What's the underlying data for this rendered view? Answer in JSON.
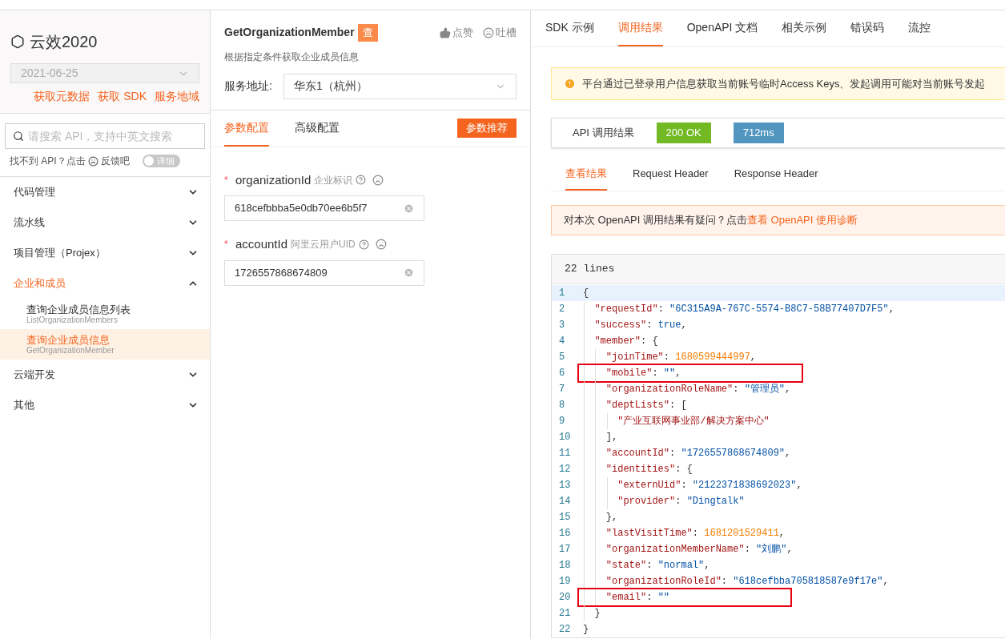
{
  "sidebar": {
    "product": "云效2020",
    "version": "2021-06-25",
    "links": [
      "获取元数据",
      "获取 SDK",
      "服务地域"
    ],
    "search": {
      "placeholder": "请搜索 API，支持中英文搜索"
    },
    "feedback": {
      "prefix": "找不到 API？点击",
      "link": "反馈吧"
    },
    "detail_toggle": {
      "label": "详细",
      "on": false
    },
    "groups": [
      {
        "label": "代码管理",
        "expanded": false
      },
      {
        "label": "流水线",
        "expanded": false
      },
      {
        "label": "项目管理（Projex）",
        "expanded": false
      },
      {
        "label": "企业和成员",
        "expanded": true,
        "children": [
          {
            "title": "查询企业成员信息列表",
            "name": "ListOrganizationMembers",
            "selected": false
          },
          {
            "title": "查询企业成员信息",
            "name": "GetOrganizationMember",
            "selected": true
          }
        ]
      },
      {
        "label": "云端开发",
        "expanded": false
      },
      {
        "label": "其他",
        "expanded": false
      }
    ]
  },
  "api": {
    "name": "GetOrganizationMember",
    "badge": "查",
    "like": "点赞",
    "complain": "吐槽",
    "description": "根据指定条件获取企业成员信息",
    "endpoint_label": "服务地址:",
    "endpoint": "华东1（杭州）",
    "tabs": [
      {
        "label": "参数配置",
        "selected": true
      },
      {
        "label": "高级配置",
        "selected": false
      }
    ],
    "recommend_button": "参数推荐",
    "params": [
      {
        "name": "organizationId",
        "hint": "企业标识",
        "required_mark": "*",
        "value": "618cefbbba5e0db70ee6b5f7"
      },
      {
        "name": "accountId",
        "hint": "阿里云用户UID",
        "required_mark": "*",
        "value": "1726557868674809"
      }
    ]
  },
  "result": {
    "tabs": [
      {
        "label": "SDK 示例",
        "selected": false
      },
      {
        "label": "调用结果",
        "selected": true
      },
      {
        "label": "OpenAPI 文档",
        "selected": false
      },
      {
        "label": "相关示例",
        "selected": false
      },
      {
        "label": "错误码",
        "selected": false
      },
      {
        "label": "流控",
        "selected": false
      }
    ],
    "warning": "平台通过已登录用户信息获取当前账号临时Access Keys、发起调用可能对当前账号发起",
    "status_label": "API 调用结果",
    "status": "200 OK",
    "duration": "712ms",
    "sub_tabs": [
      {
        "label": "查看结果",
        "selected": true
      },
      {
        "label": "Request Header",
        "selected": false
      },
      {
        "label": "Response Header",
        "selected": false
      }
    ],
    "diagnosis": {
      "text": "对本次 OpenAPI 调用结果有疑问？点击",
      "link": "查看 OpenAPI 使用诊断"
    },
    "code": {
      "line_count": "22 lines",
      "lines": [
        {
          "number": "1",
          "current": true,
          "boxed": false,
          "tokens": [
            {
              "kind": "punct",
              "text": "{"
            }
          ]
        },
        {
          "number": "2",
          "current": false,
          "boxed": false,
          "tokens": [
            {
              "kind": "key",
              "text": "  \"requestId\""
            },
            {
              "kind": "punct",
              "text": ": "
            },
            {
              "kind": "string",
              "text": "\"6C315A9A-767C-5574-B8C7-58B77407D7F5\""
            },
            {
              "kind": "punct",
              "text": ","
            }
          ]
        },
        {
          "number": "3",
          "current": false,
          "boxed": false,
          "tokens": [
            {
              "kind": "key",
              "text": "  \"success\""
            },
            {
              "kind": "punct",
              "text": ": "
            },
            {
              "kind": "string",
              "text": "true"
            },
            {
              "kind": "punct",
              "text": ","
            }
          ]
        },
        {
          "number": "4",
          "current": false,
          "boxed": false,
          "tokens": [
            {
              "kind": "key",
              "text": "  \"member\""
            },
            {
              "kind": "punct",
              "text": ": {"
            }
          ]
        },
        {
          "number": "5",
          "current": false,
          "boxed": false,
          "tokens": [
            {
              "kind": "key",
              "text": "    \"joinTime\""
            },
            {
              "kind": "punct",
              "text": ": "
            },
            {
              "kind": "number",
              "text": "1680599444997"
            },
            {
              "kind": "punct",
              "text": ","
            }
          ]
        },
        {
          "number": "6",
          "current": false,
          "boxed": true,
          "tokens": [
            {
              "kind": "key",
              "text": "    \"mobile\""
            },
            {
              "kind": "punct",
              "text": ": "
            },
            {
              "kind": "string",
              "text": "\"\""
            },
            {
              "kind": "punct",
              "text": ","
            }
          ]
        },
        {
          "number": "7",
          "current": false,
          "boxed": false,
          "tokens": [
            {
              "kind": "key",
              "text": "    \"organizationRoleName\""
            },
            {
              "kind": "punct",
              "text": ": "
            },
            {
              "kind": "string",
              "text": "\"管理员\""
            },
            {
              "kind": "punct",
              "text": ","
            }
          ]
        },
        {
          "number": "8",
          "current": false,
          "boxed": false,
          "tokens": [
            {
              "kind": "key",
              "text": "    \"deptLists\""
            },
            {
              "kind": "punct",
              "text": ": ["
            }
          ]
        },
        {
          "number": "9",
          "current": false,
          "boxed": false,
          "tokens": [
            {
              "kind": "key",
              "text": "      \"产业互联网事业部/解决方案中心\""
            }
          ]
        },
        {
          "number": "10",
          "current": false,
          "boxed": false,
          "tokens": [
            {
              "kind": "punct",
              "text": "    ],"
            }
          ]
        },
        {
          "number": "11",
          "current": false,
          "boxed": false,
          "tokens": [
            {
              "kind": "key",
              "text": "    \"accountId\""
            },
            {
              "kind": "punct",
              "text": ": "
            },
            {
              "kind": "string",
              "text": "\"1726557868674809\""
            },
            {
              "kind": "punct",
              "text": ","
            }
          ]
        },
        {
          "number": "12",
          "current": false,
          "boxed": false,
          "tokens": [
            {
              "kind": "key",
              "text": "    \"identities\""
            },
            {
              "kind": "punct",
              "text": ": {"
            }
          ]
        },
        {
          "number": "13",
          "current": false,
          "boxed": false,
          "tokens": [
            {
              "kind": "key",
              "text": "      \"externUid\""
            },
            {
              "kind": "punct",
              "text": ": "
            },
            {
              "kind": "string",
              "text": "\"2122371838692023\""
            },
            {
              "kind": "punct",
              "text": ","
            }
          ]
        },
        {
          "number": "14",
          "current": false,
          "boxed": false,
          "tokens": [
            {
              "kind": "key",
              "text": "      \"provider\""
            },
            {
              "kind": "punct",
              "text": ": "
            },
            {
              "kind": "string",
              "text": "\"Dingtalk\""
            }
          ]
        },
        {
          "number": "15",
          "current": false,
          "boxed": false,
          "tokens": [
            {
              "kind": "punct",
              "text": "    },"
            }
          ]
        },
        {
          "number": "16",
          "current": false,
          "boxed": false,
          "tokens": [
            {
              "kind": "key",
              "text": "    \"lastVisitTime\""
            },
            {
              "kind": "punct",
              "text": ": "
            },
            {
              "kind": "number",
              "text": "1681201529411"
            },
            {
              "kind": "punct",
              "text": ","
            }
          ]
        },
        {
          "number": "17",
          "current": false,
          "boxed": false,
          "tokens": [
            {
              "kind": "key",
              "text": "    \"organizationMemberName\""
            },
            {
              "kind": "punct",
              "text": ": "
            },
            {
              "kind": "string",
              "text": "\"刘鹏\""
            },
            {
              "kind": "punct",
              "text": ","
            }
          ]
        },
        {
          "number": "18",
          "current": false,
          "boxed": false,
          "tokens": [
            {
              "kind": "key",
              "text": "    \"state\""
            },
            {
              "kind": "punct",
              "text": ": "
            },
            {
              "kind": "string",
              "text": "\"normal\""
            },
            {
              "kind": "punct",
              "text": ","
            }
          ]
        },
        {
          "number": "19",
          "current": false,
          "boxed": false,
          "tokens": [
            {
              "kind": "key",
              "text": "    \"organizationRoleId\""
            },
            {
              "kind": "punct",
              "text": ": "
            },
            {
              "kind": "string",
              "text": "\"618cefbba705818587e9f17e\""
            },
            {
              "kind": "punct",
              "text": ","
            }
          ]
        },
        {
          "number": "20",
          "current": false,
          "boxed": true,
          "tokens": [
            {
              "kind": "key",
              "text": "    \"email\""
            },
            {
              "kind": "punct",
              "text": ": "
            },
            {
              "kind": "string",
              "text": "\"\""
            }
          ]
        },
        {
          "number": "21",
          "current": false,
          "boxed": false,
          "tokens": [
            {
              "kind": "punct",
              "text": "  }"
            }
          ]
        },
        {
          "number": "22",
          "current": false,
          "boxed": false,
          "tokens": [
            {
              "kind": "punct",
              "text": "}"
            }
          ]
        }
      ]
    }
  }
}
